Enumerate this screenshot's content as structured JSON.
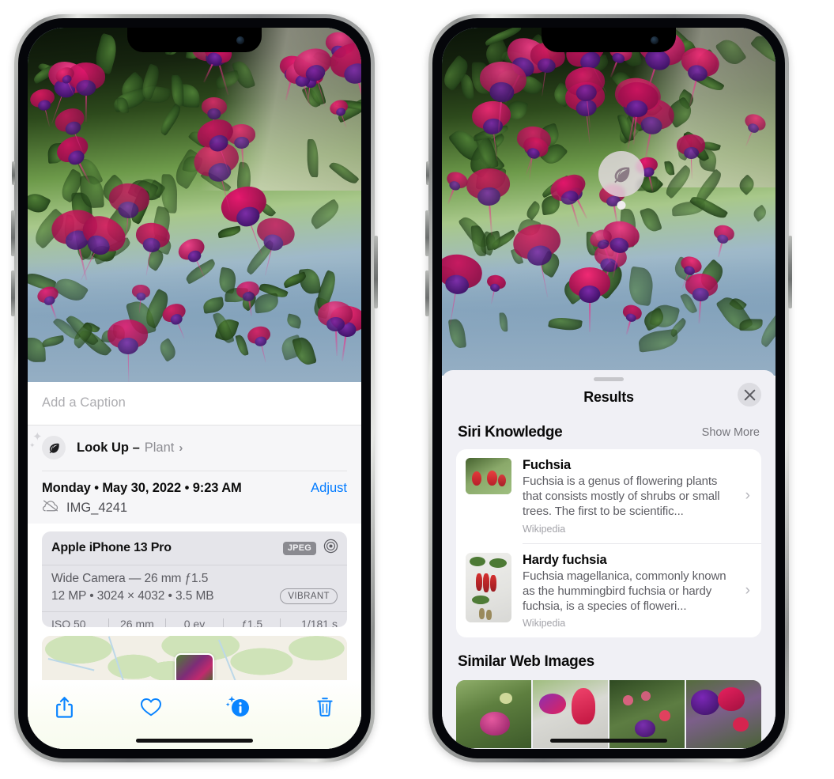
{
  "left_phone": {
    "caption": {
      "placeholder": "Add a Caption",
      "value": ""
    },
    "lookup": {
      "icon": "leaf-icon",
      "label": "Look Up –",
      "subject": "Plant",
      "chevron": "›"
    },
    "metadata": {
      "date": "Monday • May 30, 2022 • 9:23 AM",
      "adjust_label": "Adjust",
      "filename": "IMG_4241",
      "cloud_icon": "cloud-slash-icon"
    },
    "camera": {
      "device": "Apple iPhone 13 Pro",
      "format_badge": "JPEG",
      "raw_icon": "aperture-icon",
      "lens": "Wide Camera — 26 mm ƒ1.5",
      "specs": "12 MP • 3024 × 4032 • 3.5 MB",
      "style_badge": "VIBRANT",
      "exif": [
        "ISO 50",
        "26 mm",
        "0 ev",
        "ƒ1.5",
        "1/181 s"
      ]
    },
    "toolbar": [
      {
        "name": "share-icon",
        "label": "Share"
      },
      {
        "name": "heart-icon",
        "label": "Favorite"
      },
      {
        "name": "info-sparkle-icon",
        "label": "Info"
      },
      {
        "name": "trash-icon",
        "label": "Delete"
      }
    ]
  },
  "right_phone": {
    "visual_lookup_badge": {
      "icon": "leaf-icon"
    },
    "sheet": {
      "title": "Results",
      "close_icon": "close-icon"
    },
    "siri_knowledge": {
      "heading": "Siri Knowledge",
      "action": "Show More",
      "items": [
        {
          "title": "Fuchsia",
          "description": "Fuchsia is a genus of flowering plants that consists mostly of shrubs or small trees. The first to be scientific...",
          "source": "Wikipedia",
          "chevron": "›"
        },
        {
          "title": "Hardy fuchsia",
          "description": "Fuchsia magellanica, commonly known as the hummingbird fuchsia or hardy fuchsia, is a species of floweri...",
          "source": "Wikipedia",
          "chevron": "›"
        }
      ]
    },
    "similar_web_images": {
      "heading": "Similar Web Images",
      "tiles": [
        "fuchsia-thumb-1",
        "fuchsia-thumb-2",
        "fuchsia-thumb-3",
        "fuchsia-thumb-4"
      ]
    }
  },
  "colors": {
    "accent_blue": "#007aff",
    "sheet_bg": "#f0f0f5",
    "card_bg": "#ffffff",
    "camera_card_bg": "#e5e5ea",
    "secondary_text": "#5d5d63",
    "tertiary_text": "#a3a3a9"
  }
}
